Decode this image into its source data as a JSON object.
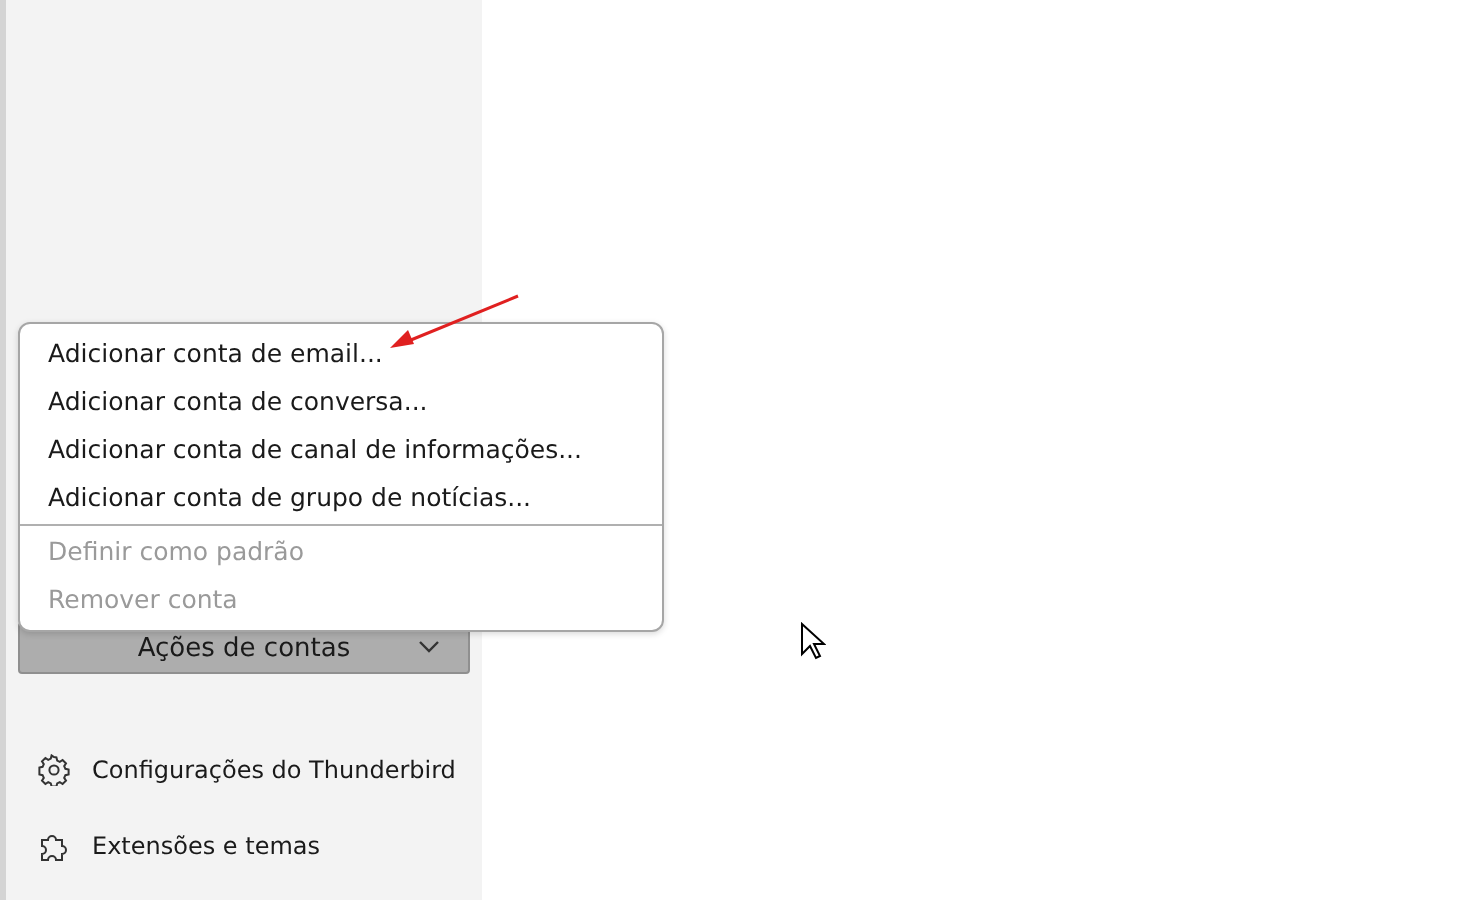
{
  "menu": {
    "items": [
      {
        "label": "Adicionar conta de email...",
        "disabled": false
      },
      {
        "label": "Adicionar conta de conversa...",
        "disabled": false
      },
      {
        "label": "Adicionar conta de canal de informações...",
        "disabled": false
      },
      {
        "label": "Adicionar conta de grupo de notícias...",
        "disabled": false,
        "separator_after": true
      },
      {
        "label": "Definir como padrão",
        "disabled": true
      },
      {
        "label": "Remover conta",
        "disabled": true
      }
    ]
  },
  "account_actions_button": {
    "label": "Ações de contas",
    "expanded": true
  },
  "sidebar": {
    "items": [
      {
        "label": "Configurações do Thunderbird",
        "kind": "settings"
      },
      {
        "label": "Extensões e temas",
        "kind": "addons"
      }
    ]
  }
}
